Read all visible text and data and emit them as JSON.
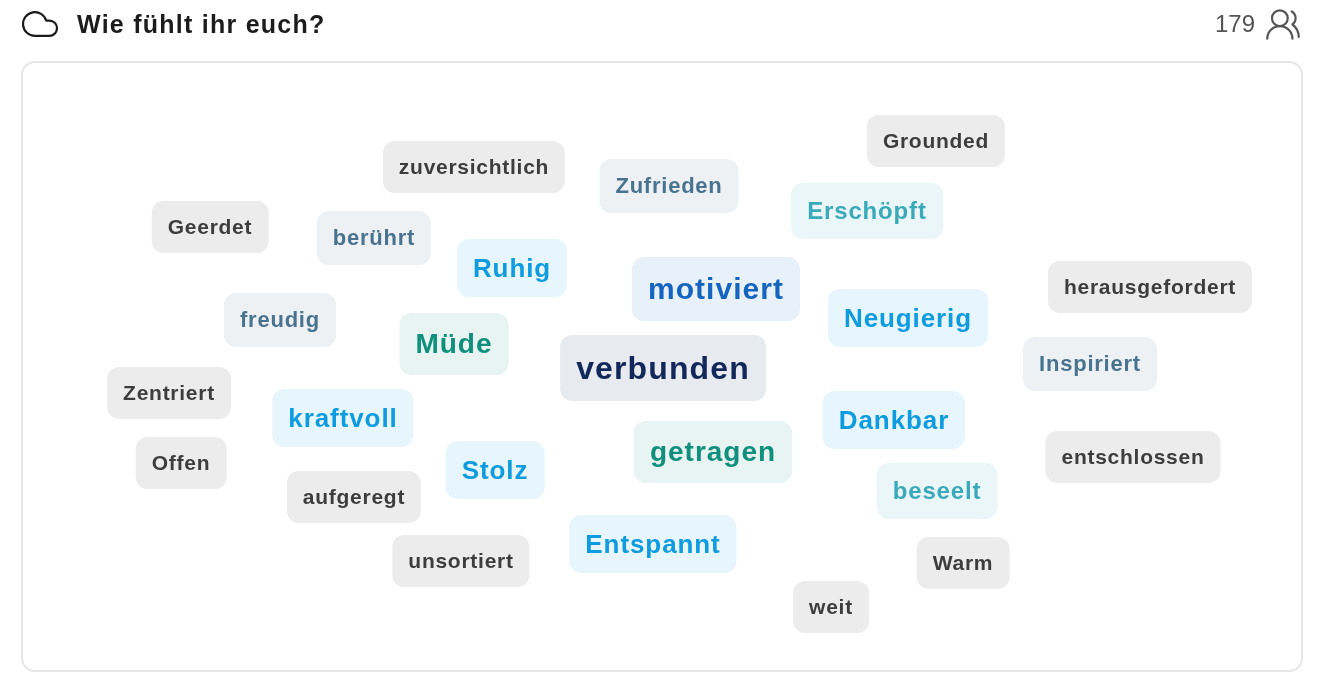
{
  "header": {
    "title": "Wie fühlt ihr euch?",
    "count": "179"
  },
  "words": [
    {
      "text": "zuversichtlich",
      "color": "#3d3d3d",
      "kind": "xs"
    },
    {
      "text": "Grounded",
      "color": "#3d3d3d",
      "kind": "xs"
    },
    {
      "text": "Zufrieden",
      "color": "#4a7390",
      "kind": "sm"
    },
    {
      "text": "Geerdet",
      "color": "#3d3d3d",
      "kind": "xs"
    },
    {
      "text": "berührt",
      "color": "#4a7390",
      "kind": "sm"
    },
    {
      "text": "Erschöpft",
      "color": "#3aa9b9",
      "kind": "md"
    },
    {
      "text": "Ruhig",
      "color": "#0e9be0",
      "kind": "lg"
    },
    {
      "text": "motiviert",
      "color": "#1565c0",
      "kind": "xxl"
    },
    {
      "text": "herausgefordert",
      "color": "#3d3d3d",
      "kind": "xs"
    },
    {
      "text": "freudig",
      "color": "#4a7390",
      "kind": "sm"
    },
    {
      "text": "Neugierig",
      "color": "#0e9be0",
      "kind": "lg"
    },
    {
      "text": "Müde",
      "color": "#0f8f7c",
      "kind": "xl"
    },
    {
      "text": "verbunden",
      "color": "#13285a",
      "kind": "max"
    },
    {
      "text": "Inspiriert",
      "color": "#4a7390",
      "kind": "sm"
    },
    {
      "text": "Zentriert",
      "color": "#3d3d3d",
      "kind": "xs"
    },
    {
      "text": "kraftvoll",
      "color": "#0e9be0",
      "kind": "lg"
    },
    {
      "text": "Dankbar",
      "color": "#0e9be0",
      "kind": "lg"
    },
    {
      "text": "Offen",
      "color": "#3d3d3d",
      "kind": "xs"
    },
    {
      "text": "getragen",
      "color": "#0f8f7c",
      "kind": "xl"
    },
    {
      "text": "entschlossen",
      "color": "#3d3d3d",
      "kind": "xs"
    },
    {
      "text": "Stolz",
      "color": "#0e9be0",
      "kind": "lg"
    },
    {
      "text": "aufgeregt",
      "color": "#3d3d3d",
      "kind": "xs"
    },
    {
      "text": "beseelt",
      "color": "#3aa9b9",
      "kind": "md"
    },
    {
      "text": "Entspannt",
      "color": "#0e9be0",
      "kind": "lg"
    },
    {
      "text": "unsortiert",
      "color": "#3d3d3d",
      "kind": "xs"
    },
    {
      "text": "Warm",
      "color": "#3d3d3d",
      "kind": "xs"
    },
    {
      "text": "weit",
      "color": "#3d3d3d",
      "kind": "xs"
    }
  ]
}
